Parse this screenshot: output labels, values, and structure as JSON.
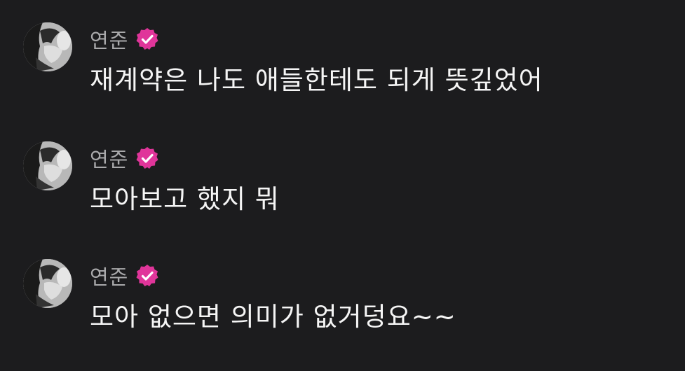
{
  "messages": [
    {
      "author": "연준",
      "verified": true,
      "text": "재계약은 나도 애들한테도 되게 뜻깊었어"
    },
    {
      "author": "연준",
      "verified": true,
      "text": "모아보고 했지 뭐"
    },
    {
      "author": "연준",
      "verified": true,
      "text": "모아 없으면 의미가 없거덩요~~"
    }
  ],
  "colors": {
    "background": "#1c1c1e",
    "author": "#a9a9ab",
    "text": "#f5f5f5",
    "verified_badge": "#e0359a"
  },
  "icons": {
    "avatar": "avatar-photo",
    "verified": "verified-badge-icon"
  }
}
